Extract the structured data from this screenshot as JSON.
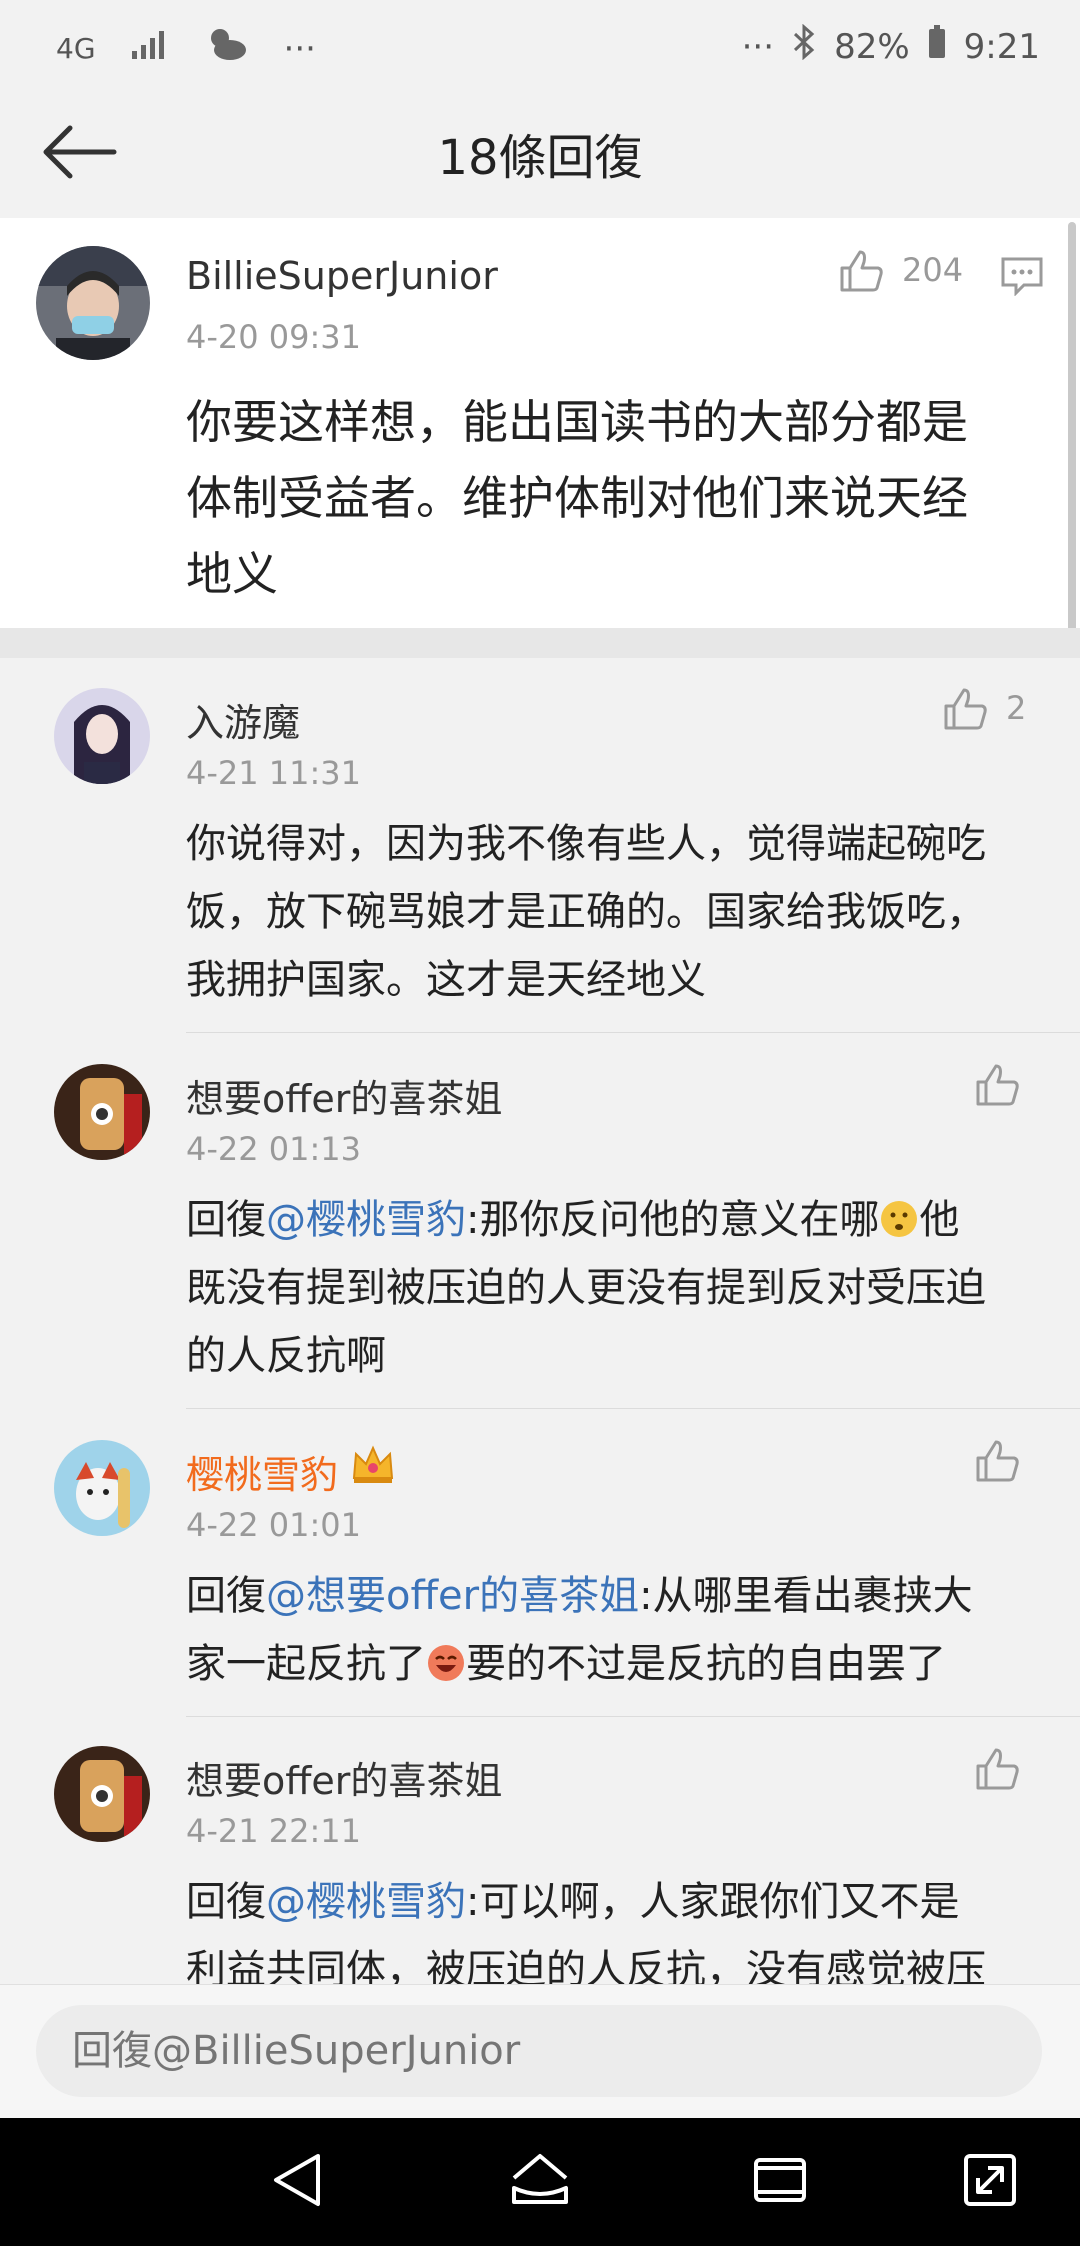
{
  "status": {
    "network": "4G",
    "battery": "82%",
    "time": "9:21",
    "more_left": "···",
    "more_right": "···"
  },
  "header": {
    "title": "18條回復"
  },
  "main_comment": {
    "name": "BillieSuperJunior",
    "time": "4-20 09:31",
    "likes": "204",
    "line1": "你要这样想，能出国读书的大部分都是",
    "line2": "体制受益者。维护体制对他们来说天经",
    "line3": "地义"
  },
  "replies": [
    {
      "name": "入游魔",
      "time": "4-21 11:31",
      "likes": "2",
      "line1": "你说得对，因为我不像有些人，觉得端起碗吃",
      "line2": "饭，放下碗骂娘才是正确的。国家给我饭吃，",
      "line3": "我拥护国家。这才是天经地义"
    },
    {
      "name": "想要offer的喜茶姐",
      "time": "4-22 01:13",
      "prefix": "回復",
      "mention": "@樱桃雪豹",
      "line1_rest": ":那你反问他的意义在哪",
      "line1_end": "他",
      "line2": "既没有提到被压迫的人更没有提到反对受压迫",
      "line3": "的人反抗啊"
    },
    {
      "name": "樱桃雪豹",
      "time": "4-22 01:01",
      "prefix": "回復",
      "mention": "@想要offer的喜茶姐",
      "line1_rest": ":从哪里看出裹挟大",
      "line2a": "家一起反抗了",
      "line2b": "要的不过是反抗的自由罢了"
    },
    {
      "name": "想要offer的喜茶姐",
      "time": "4-21 22:11",
      "prefix": "回復",
      "mention": "@樱桃雪豹",
      "line1_rest": ":可以啊，人家跟你们又不是",
      "line2": "利益共同体，被压迫的人反抗，没有感觉被压"
    }
  ],
  "reply_box": {
    "placeholder": "回復@BillieSuperJunior"
  },
  "colors": {
    "accent_name": "#f26b1d",
    "mention": "#3b73b9",
    "background": "#f2f2f2"
  }
}
